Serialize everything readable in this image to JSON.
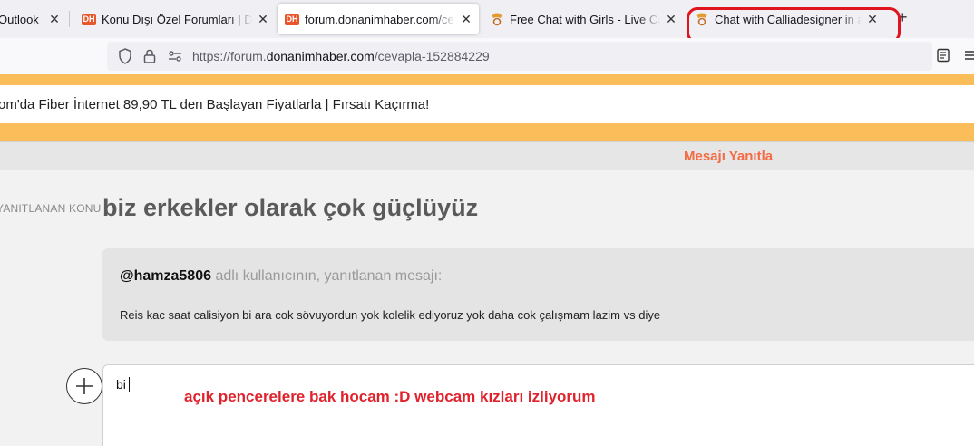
{
  "browser": {
    "tabs": [
      {
        "title": "Outlook",
        "icon": "outlook-icon",
        "active": false
      },
      {
        "title": "Konu Dışı Özel Forumları | Donanım",
        "icon": "donanimhaber-icon",
        "active": false
      },
      {
        "title": "forum.donanimhaber.com/cevapla",
        "icon": "donanimhaber-icon",
        "active": true
      },
      {
        "title": "Free Chat with Girls - Live Cam",
        "icon": "chat-site-icon",
        "active": false
      },
      {
        "title": "Chat with Calliadesigner in a Live",
        "icon": "chat-site-icon",
        "active": false
      }
    ],
    "url_prefix": "https://forum.",
    "url_domain": "donanimhaber.com",
    "url_path": "/cevapla-152884229"
  },
  "page": {
    "promo_text": "om'da Fiber İnternet 89,90 TL den Başlayan Fiyatlarla | Fırsatı Kaçırma!",
    "reply_header": "Mesajı Yanıtla",
    "side_label": "YANITLANAN KONU",
    "topic_title": "biz erkekler olarak çok güçlüyüz",
    "quote": {
      "username": "@hamza5806",
      "suffix": " adlı kullanıcının, yanıtlanan mesajı:",
      "body": "Reis kac saat calisiyon bi ara cok sövuyordun yok kolelik ediyoruz yok daha cok çalışmam lazim vs diye"
    },
    "editor_text": "bi",
    "annotation": "açık pencerelere bak hocam :D webcam kızları izliyorum"
  },
  "colors": {
    "accent_orange": "#fbbd5a",
    "reply_header": "#f36b44",
    "annotation_red": "#e0222c"
  }
}
